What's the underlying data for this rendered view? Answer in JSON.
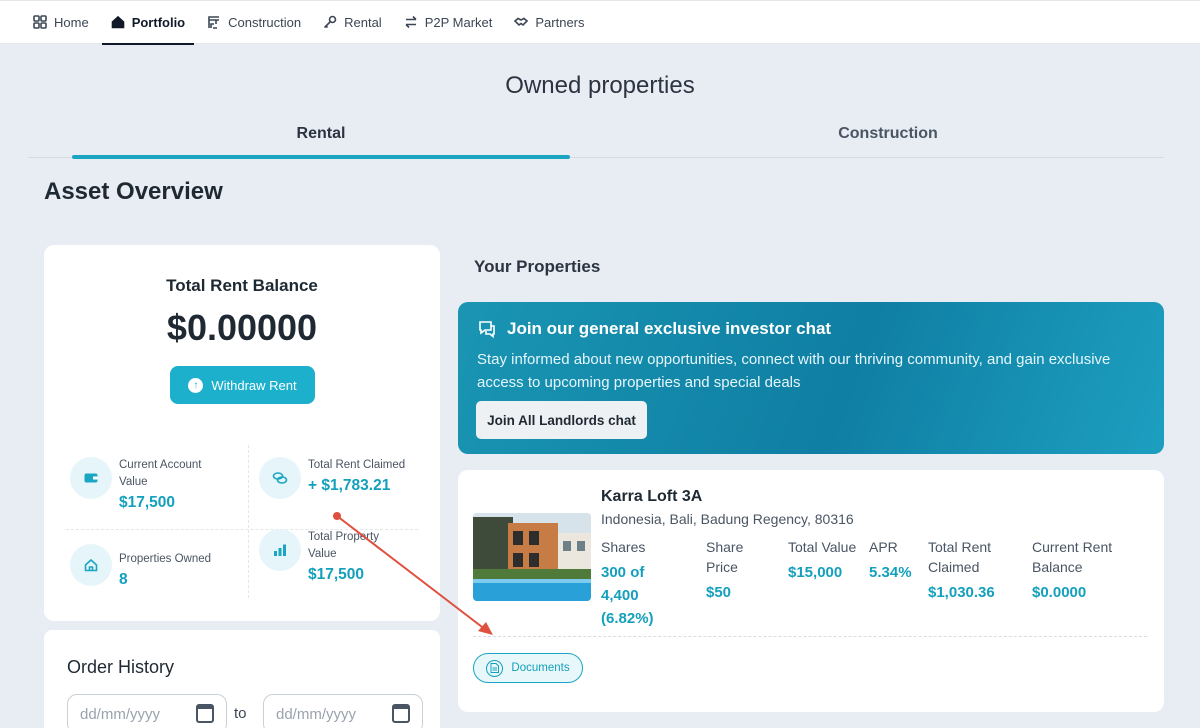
{
  "nav": {
    "items": [
      {
        "label": "Home",
        "icon": "grid-icon"
      },
      {
        "label": "Portfolio",
        "icon": "house-icon",
        "active": true
      },
      {
        "label": "Construction",
        "icon": "crane-icon"
      },
      {
        "label": "Rental",
        "icon": "key-icon"
      },
      {
        "label": "P2P Market",
        "icon": "swap-icon"
      },
      {
        "label": "Partners",
        "icon": "handshake-icon"
      }
    ]
  },
  "page": {
    "title": "Owned properties",
    "tabs": [
      {
        "label": "Rental",
        "active": true
      },
      {
        "label": "Construction",
        "active": false
      }
    ],
    "section_title": "Asset Overview"
  },
  "balance": {
    "label": "Total Rent Balance",
    "value": "$0.00000",
    "withdraw_label": "Withdraw Rent"
  },
  "stats": {
    "current_account": {
      "label": "Current Account Value",
      "value": "$17,500"
    },
    "rent_claimed": {
      "label": "Total Rent Claimed",
      "value": "+ $1,783.21"
    },
    "properties_owned": {
      "label": "Properties Owned",
      "value": "8"
    },
    "property_value": {
      "label": "Total Property Value",
      "value": "$17,500"
    }
  },
  "order_history": {
    "title": "Order History",
    "from_placeholder": "dd/mm/yyyy",
    "to_label": "to",
    "to_placeholder": "dd/mm/yyyy"
  },
  "properties": {
    "title": "Your Properties",
    "promo": {
      "title": "Join our general exclusive investor chat",
      "description": "Stay informed about new opportunities, connect with our thriving community, and gain exclusive access to upcoming properties and special deals",
      "button": "Join All Landlords chat"
    },
    "item": {
      "name": "Karra Loft 3A",
      "address": "Indonesia, Bali, Badung Regency, 80316",
      "columns": [
        {
          "label": "Shares",
          "value": "300 of 4,400 (6.82%)"
        },
        {
          "label": "Share Price",
          "value": "$50"
        },
        {
          "label": "Total Value",
          "value": "$15,000"
        },
        {
          "label": "APR",
          "value": "5.34%"
        },
        {
          "label": "Total Rent Claimed",
          "value": "$1,030.36"
        },
        {
          "label": "Current Rent Balance",
          "value": "$0.0000"
        }
      ],
      "documents_label": "Documents"
    }
  },
  "colors": {
    "accent": "#1aa6c2",
    "background": "#e8edf4",
    "annotation_arrow": "#e0503f"
  }
}
